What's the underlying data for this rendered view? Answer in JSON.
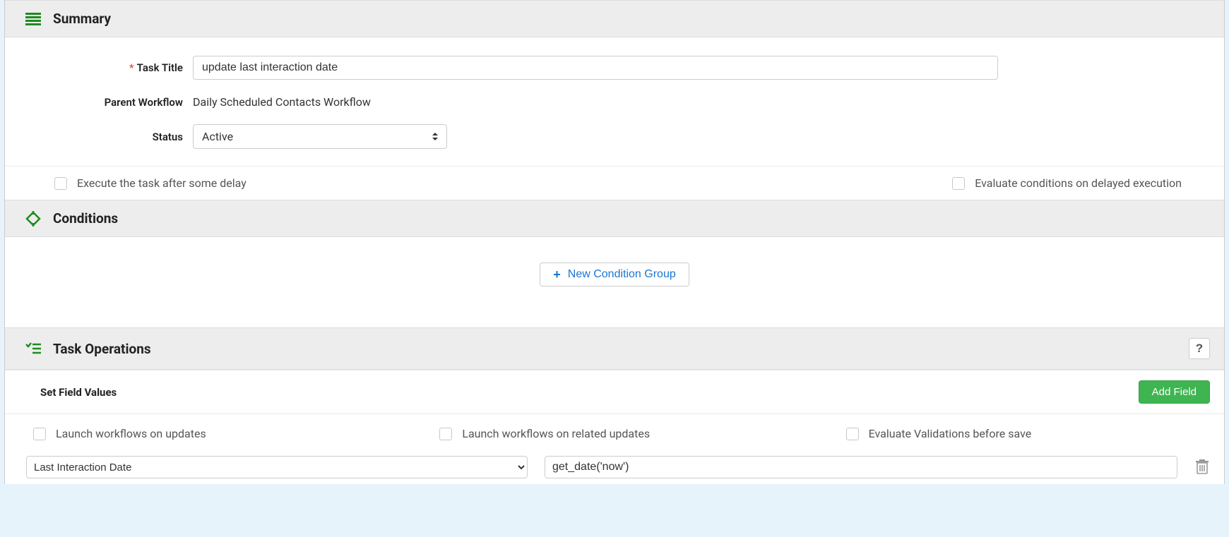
{
  "summary": {
    "heading": "Summary",
    "task_title_label": "Task Title",
    "task_title_value": "update last interaction date",
    "parent_workflow_label": "Parent Workflow",
    "parent_workflow_value": "Daily Scheduled Contacts Workflow",
    "status_label": "Status",
    "status_value": "Active",
    "delay_checkbox_label": "Execute the task after some delay",
    "evaluate_delayed_label": "Evaluate conditions on delayed execution"
  },
  "conditions": {
    "heading": "Conditions",
    "new_group_label": "New Condition Group"
  },
  "operations": {
    "heading": "Task Operations",
    "help_label": "?",
    "subheader": "Set Field Values",
    "add_field_label": "Add Field",
    "checkboxes": {
      "launch_updates": "Launch workflows on updates",
      "launch_related": "Launch workflows on related updates",
      "evaluate_validations": "Evaluate Validations before save"
    },
    "field_row": {
      "field_name": "Last Interaction Date",
      "expression": "get_date('now')"
    }
  }
}
